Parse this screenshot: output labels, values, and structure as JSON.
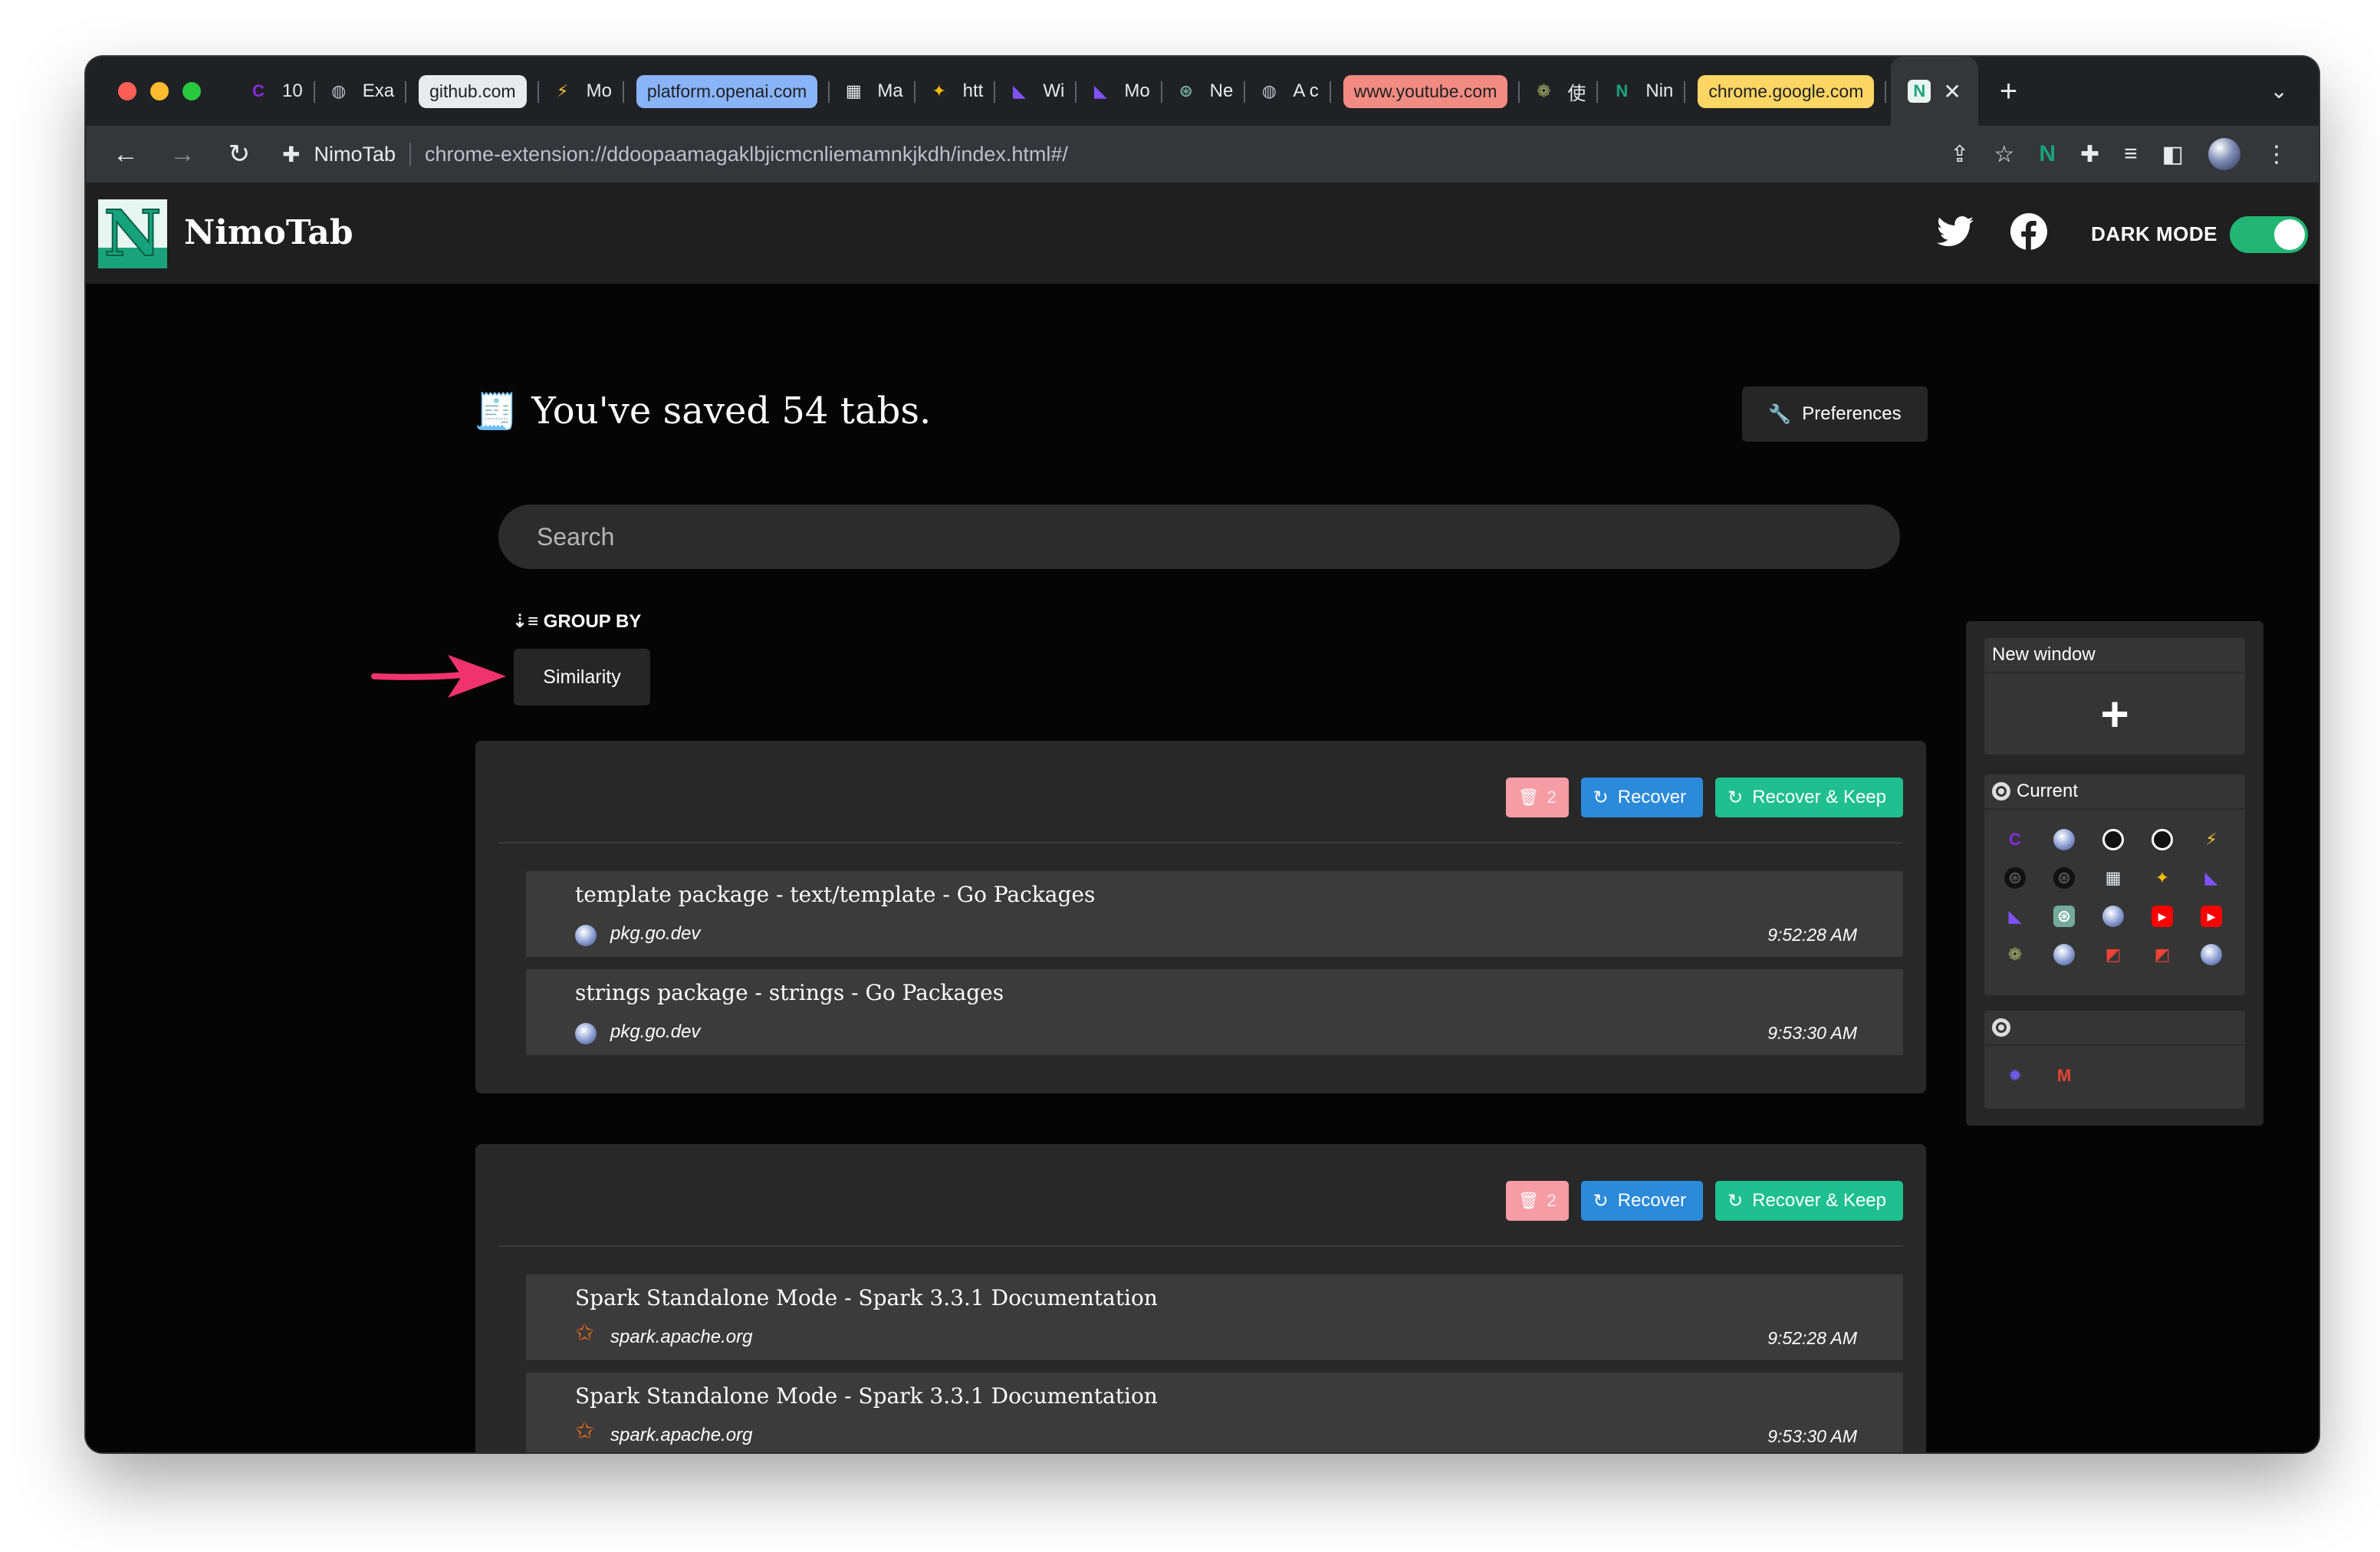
{
  "browser": {
    "tabs": [
      {
        "label": "10",
        "icon": "purple-c-icon",
        "glyph": "C",
        "color": "#8a2be2",
        "pill": null
      },
      {
        "label": "Exa",
        "icon": "globe-icon",
        "glyph": "◍",
        "color": "#bdc1c6",
        "pill": null
      },
      {
        "label": "github.com",
        "icon": "",
        "glyph": "",
        "color": "",
        "pill": "#e8eaed"
      },
      {
        "label": "Mo",
        "icon": "bolt-icon",
        "glyph": "⚡",
        "color": "#f4c430",
        "pill": null
      },
      {
        "label": "platform.openai.com",
        "icon": "",
        "glyph": "",
        "color": "",
        "pill": "#8ab4f8"
      },
      {
        "label": "Ma",
        "icon": "grid-app-icon",
        "glyph": "▦",
        "color": "#e8eaed",
        "pill": null
      },
      {
        "label": "htt",
        "icon": "sparkle-icon",
        "glyph": "✦",
        "color": "#fbbc04",
        "pill": null
      },
      {
        "label": "Wi",
        "icon": "kotlin-icon",
        "glyph": "◣",
        "color": "#7f52ff",
        "pill": null
      },
      {
        "label": "Mo",
        "icon": "kotlin-icon",
        "glyph": "◣",
        "color": "#7f52ff",
        "pill": null
      },
      {
        "label": "Ne",
        "icon": "openai-icon",
        "glyph": "⊛",
        "color": "#74aa9c",
        "pill": null
      },
      {
        "label": "A c",
        "icon": "globe-icon",
        "glyph": "◍",
        "color": "#bdc1c6",
        "pill": null
      },
      {
        "label": "www.youtube.com",
        "icon": "",
        "glyph": "",
        "color": "",
        "pill": "#f28b82"
      },
      {
        "label": "使",
        "icon": "flower-icon",
        "glyph": "❁",
        "color": "#a9b36b",
        "pill": null
      },
      {
        "label": "Nin",
        "icon": "nimotab-icon",
        "glyph": "N",
        "color": "#1aa37a",
        "pill": null
      },
      {
        "label": "chrome.google.com",
        "icon": "",
        "glyph": "",
        "color": "",
        "pill": "#fdd663"
      }
    ],
    "active_tab_icon": "nimotab-icon",
    "omnibox": {
      "site_name": "NimoTab",
      "url": "chrome-extension://ddoopaamagaklbjicmcnliemamnkjkdh/index.html#/"
    }
  },
  "app": {
    "brand": "NimoTab",
    "dark_mode_label": "DARK MODE",
    "dark_mode_on": true,
    "headline": "You've saved 54 tabs.",
    "preferences_label": "Preferences",
    "search_placeholder": "Search",
    "group_by_label": "GROUP BY",
    "group_by_value": "Similarity",
    "groups": [
      {
        "count": "2",
        "recover_label": "Recover",
        "recover_keep_label": "Recover & Keep",
        "items": [
          {
            "title": "template package - text/template - Go Packages",
            "domain": "pkg.go.dev",
            "time": "9:52:28 AM",
            "icon": "go-globe-icon"
          },
          {
            "title": "strings package - strings - Go Packages",
            "domain": "pkg.go.dev",
            "time": "9:53:30 AM",
            "icon": "go-globe-icon"
          }
        ]
      },
      {
        "count": "2",
        "recover_label": "Recover",
        "recover_keep_label": "Recover & Keep",
        "items": [
          {
            "title": "Spark Standalone Mode - Spark 3.3.1 Documentation",
            "domain": "spark.apache.org",
            "time": "9:52:28 AM",
            "icon": "spark-icon"
          },
          {
            "title": "Spark Standalone Mode - Spark 3.3.1 Documentation",
            "domain": "spark.apache.org",
            "time": "9:53:30 AM",
            "icon": "spark-icon"
          }
        ]
      }
    ],
    "side_panel": {
      "new_window_label": "New window",
      "current_label": "Current",
      "current_icons": [
        {
          "name": "purple-c-icon",
          "glyph": "C",
          "color": "#8a2be2"
        },
        {
          "name": "globe-icon",
          "glyph": "●",
          "color": "#9fb2e6"
        },
        {
          "name": "github-icon",
          "glyph": "●",
          "color": "#ffffff"
        },
        {
          "name": "github-icon",
          "glyph": "●",
          "color": "#ffffff"
        },
        {
          "name": "bolt-icon",
          "glyph": "⚡",
          "color": "#f4c430"
        },
        {
          "name": "openai-icon",
          "glyph": "⊛",
          "color": "#1a1a1a"
        },
        {
          "name": "openai-icon",
          "glyph": "⊛",
          "color": "#1a1a1a"
        },
        {
          "name": "grid-app-icon",
          "glyph": "▦",
          "color": "#e8eaed"
        },
        {
          "name": "sparkle-icon",
          "glyph": "✦",
          "color": "#fbbc04"
        },
        {
          "name": "kotlin-icon",
          "glyph": "◣",
          "color": "#7f52ff"
        },
        {
          "name": "kotlin-icon",
          "glyph": "◣",
          "color": "#7f52ff"
        },
        {
          "name": "openai-icon",
          "glyph": "⊛",
          "color": "#74aa9c"
        },
        {
          "name": "globe-icon",
          "glyph": "●",
          "color": "#9fb2e6"
        },
        {
          "name": "youtube-icon",
          "glyph": "▶",
          "color": "#ff0000"
        },
        {
          "name": "youtube-icon",
          "glyph": "▶",
          "color": "#ff0000"
        },
        {
          "name": "flower-icon",
          "glyph": "❁",
          "color": "#a9b36b"
        },
        {
          "name": "globe-icon",
          "glyph": "●",
          "color": "#9fb2e6"
        },
        {
          "name": "chrome-store-icon",
          "glyph": "◩",
          "color": "#ea4335"
        },
        {
          "name": "chrome-store-icon",
          "glyph": "◩",
          "color": "#ea4335"
        },
        {
          "name": "globe-icon",
          "glyph": "●",
          "color": "#9fb2e6"
        }
      ],
      "other_window_icons": [
        {
          "name": "sun-gear-icon",
          "glyph": "✹",
          "color": "#6c5ce7"
        },
        {
          "name": "gmail-icon",
          "glyph": "M",
          "color": "#ea4335"
        }
      ]
    }
  }
}
